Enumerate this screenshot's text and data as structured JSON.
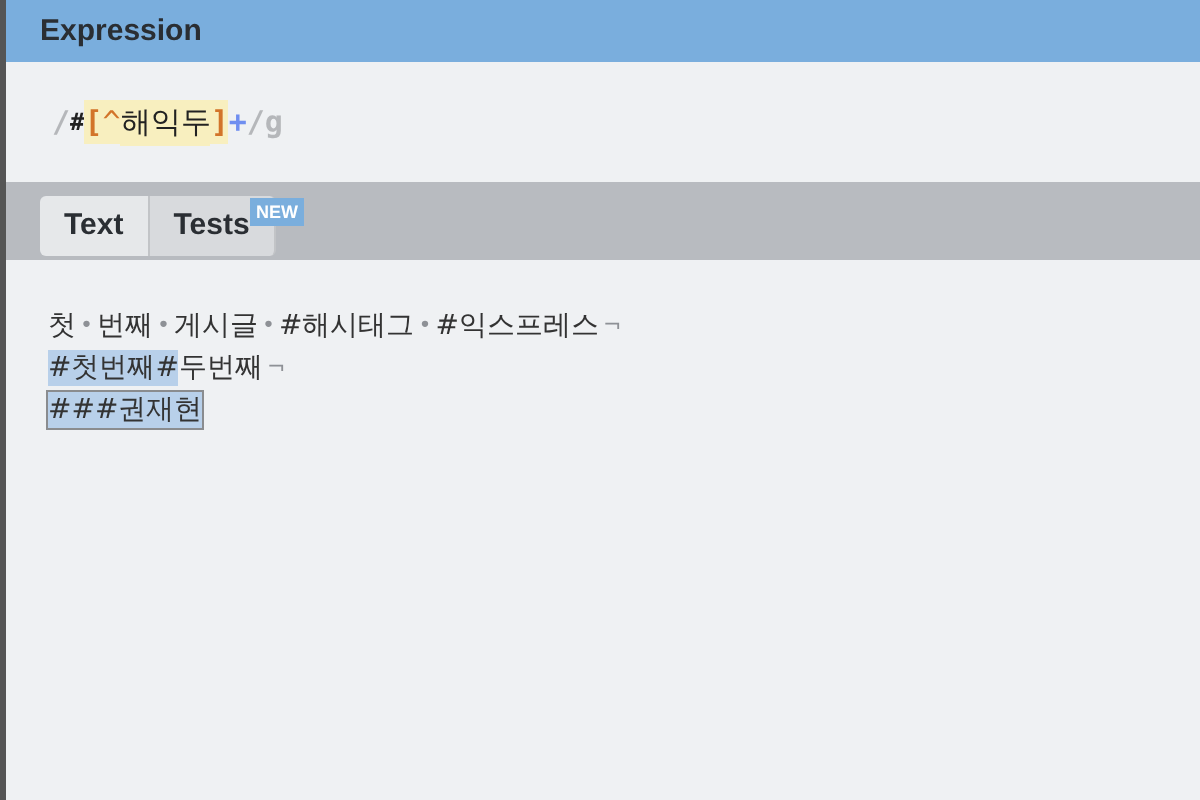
{
  "header": {
    "title": "Expression"
  },
  "expression": [
    {
      "text": "/",
      "kind": "delim"
    },
    {
      "text": "#",
      "kind": "char"
    },
    {
      "text": "[",
      "kind": "set-bracket"
    },
    {
      "text": "^",
      "kind": "set-neg"
    },
    {
      "text": "해익두",
      "kind": "set-char"
    },
    {
      "text": "]",
      "kind": "set-bracket"
    },
    {
      "text": "+",
      "kind": "quant"
    },
    {
      "text": "/",
      "kind": "delim"
    },
    {
      "text": "g",
      "kind": "flag"
    }
  ],
  "tabs": [
    {
      "label": "Text",
      "selected": true
    },
    {
      "label": "Tests",
      "selected": false,
      "badge": "NEW"
    }
  ],
  "lines": [
    [
      {
        "text": "첫",
        "kind": "plain"
      },
      {
        "text": "•",
        "kind": "ws"
      },
      {
        "text": "번째",
        "kind": "plain"
      },
      {
        "text": "•",
        "kind": "ws"
      },
      {
        "text": "게시글",
        "kind": "plain"
      },
      {
        "text": "•",
        "kind": "ws"
      },
      {
        "text": "#해시태그",
        "kind": "plain"
      },
      {
        "text": "•",
        "kind": "ws"
      },
      {
        "text": "#익스프레스",
        "kind": "plain"
      },
      {
        "text": "¬",
        "kind": "ws"
      }
    ],
    [
      {
        "text": "#첫번째#",
        "kind": "match"
      },
      {
        "text": "두번째",
        "kind": "plain"
      },
      {
        "text": "¬",
        "kind": "ws"
      }
    ],
    [
      {
        "text": "###권재현",
        "kind": "match-selected"
      }
    ]
  ]
}
